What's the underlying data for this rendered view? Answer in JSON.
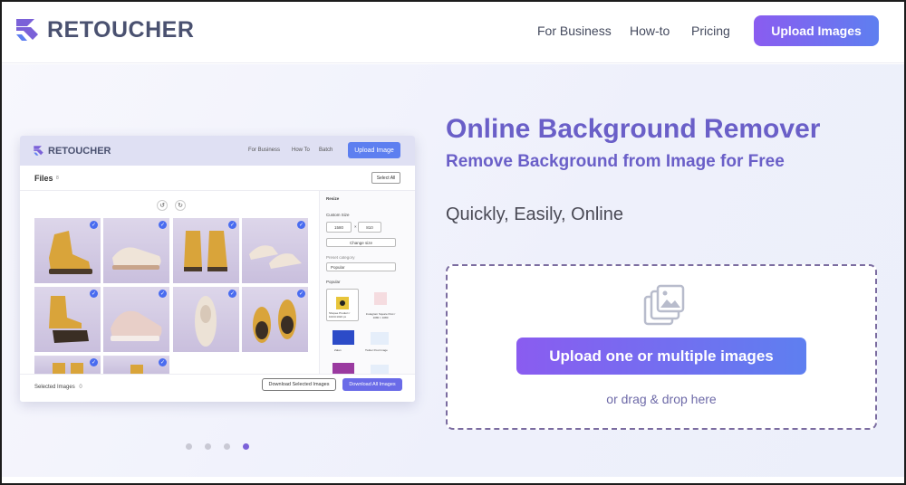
{
  "header": {
    "brand": "RETOUCHER",
    "nav": [
      "For Business",
      "How-to",
      "Pricing"
    ],
    "cta": "Upload Images"
  },
  "hero": {
    "title": "Online Background Remover",
    "subtitle": "Remove Background from Image for Free",
    "tagline": "Quickly, Easily, Online",
    "upload_button": "Upload one or multiple images",
    "drop_hint": "or drag & drop here"
  },
  "mockup": {
    "brand": "RETOUCHER",
    "nav": [
      "For Business",
      "How To",
      "Batch"
    ],
    "upload": "Upload Image",
    "files_label": "Files",
    "files_count": "8",
    "select_all": "Select All",
    "sidebar": {
      "title": "Resize",
      "custom_size": "Custom Size",
      "width": "1580",
      "height": "810",
      "times": "×",
      "change_size": "Change size",
      "preset_label": "Preset category",
      "preset_value": "Popular",
      "popular_label": "Popular",
      "item1": "Shopee Product / 1024×1024 px",
      "item2": "Instagram Square Post / 1080 × 1080",
      "item3": "Zalan",
      "item4": "Twitter Post Image"
    },
    "selected_label": "Selected Images",
    "selected_count": "0",
    "download_selected": "Download Selected Images",
    "download_all": "Download All Images"
  },
  "carousel": {
    "count": 4,
    "active_index": 3
  },
  "colors": {
    "accent_purple": "#8a5cf0",
    "accent_blue": "#5e7ff0",
    "title_color": "#6a5fc8"
  }
}
